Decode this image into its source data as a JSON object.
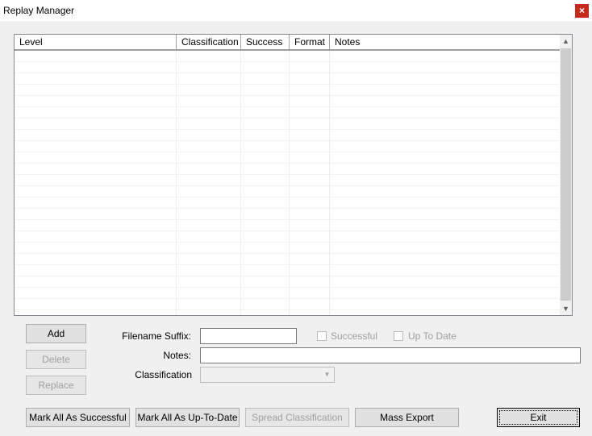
{
  "window": {
    "title": "Replay Manager",
    "close_glyph": "×"
  },
  "list": {
    "columns": [
      "Level",
      "Classification",
      "Success",
      "Format",
      "Notes"
    ],
    "scroll_up": "▲",
    "scroll_down": "▼"
  },
  "buttons": {
    "add": "Add",
    "delete": "Delete",
    "replace": "Replace",
    "mark_all_successful": "Mark All As Successful",
    "mark_all_uptodate": "Mark All As Up-To-Date",
    "spread_classification": "Spread Classification",
    "mass_export": "Mass Export",
    "exit": "Exit"
  },
  "form": {
    "filename_suffix_label": "Filename Suffix:",
    "filename_suffix_value": "",
    "successful_label": "Successful",
    "up_to_date_label": "Up To Date",
    "notes_label": "Notes:",
    "notes_value": "",
    "classification_label": "Classification",
    "classification_value": ""
  }
}
